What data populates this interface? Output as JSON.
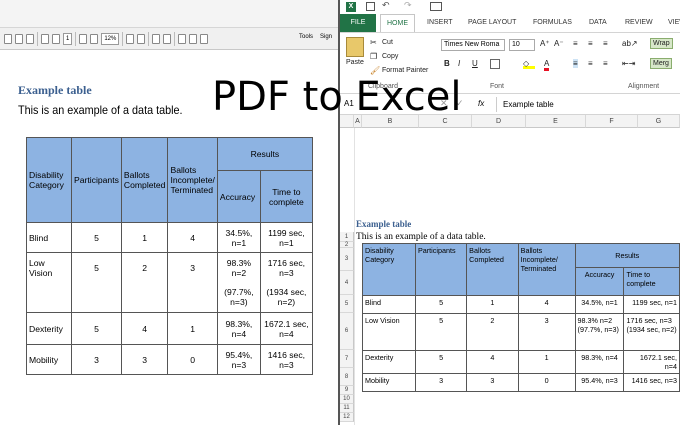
{
  "overlay_title": "PDF to Excel",
  "pdf": {
    "toolbar": {
      "page": "1",
      "zoom": "12%",
      "tools": "Tools",
      "sign": "Sign"
    },
    "heading": "Example table",
    "subtitle": "This is an example of a data table.",
    "table": {
      "headers": [
        "Disability Category",
        "Participants",
        "Ballots Completed",
        "Ballots Incomplete/ Terminated",
        "Results"
      ],
      "subheaders": [
        "Accuracy",
        "Time to complete"
      ],
      "rows": [
        [
          "Blind",
          "5",
          "1",
          "4",
          "34.5%, n=1",
          "1199 sec, n=1"
        ],
        [
          "Low Vision",
          "5",
          "2",
          "3",
          "98.3% n=2",
          "1716 sec, n=3"
        ],
        [
          "",
          "",
          "",
          "",
          "(97.7%, n=3)",
          "(1934 sec, n=2)"
        ],
        [
          "Dexterity",
          "5",
          "4",
          "1",
          "98.3%, n=4",
          "1672.1 sec, n=4"
        ],
        [
          "Mobility",
          "3",
          "3",
          "0",
          "95.4%, n=3",
          "1416 sec, n=3"
        ]
      ]
    }
  },
  "excel": {
    "tabs": [
      "FILE",
      "HOME",
      "INSERT",
      "PAGE LAYOUT",
      "FORMULAS",
      "DATA",
      "REVIEW",
      "VIEW"
    ],
    "clipboard": {
      "paste": "Paste",
      "cut": "Cut",
      "copy": "Copy",
      "format_painter": "Format Painter",
      "label": "Clipboard"
    },
    "font": {
      "name": "Times New Roma",
      "size": "10",
      "label": "Font"
    },
    "alignment": {
      "wrap": "Wrap",
      "merge": "Merg",
      "label": "Alignment"
    },
    "name_box": "A1",
    "fx": "fx",
    "formula_value": "Example table",
    "columns": [
      "A",
      "B",
      "C",
      "D",
      "E",
      "F",
      "G"
    ],
    "row_numbers": [
      "1",
      "2",
      "3",
      "4",
      "5",
      "6",
      "7",
      "8",
      "9",
      "10",
      "11",
      "12"
    ],
    "heading": "Example table",
    "subtitle": "This is an example of a data table.",
    "table": {
      "headers": [
        "Disability Category",
        "Participants",
        "Ballots Completed",
        "Ballots Incomplete/ Terminated",
        "Results"
      ],
      "subheaders": [
        "Accuracy",
        "Time to complete"
      ],
      "rows": [
        [
          "Blind",
          "5",
          "1",
          "4",
          "34.5%, n=1",
          "1199 sec, n=1"
        ],
        [
          "Low Vision",
          "5",
          "2",
          "3",
          "98.3% n=2 (97.7%, n=3)",
          "1716 sec, n=3 (1934 sec, n=2)"
        ],
        [
          "Dexterity",
          "5",
          "4",
          "1",
          "98.3%, n=4",
          "1672.1 sec, n=4"
        ],
        [
          "Mobility",
          "3",
          "3",
          "0",
          "95.4%, n=3",
          "1416 sec, n=3"
        ]
      ]
    }
  }
}
